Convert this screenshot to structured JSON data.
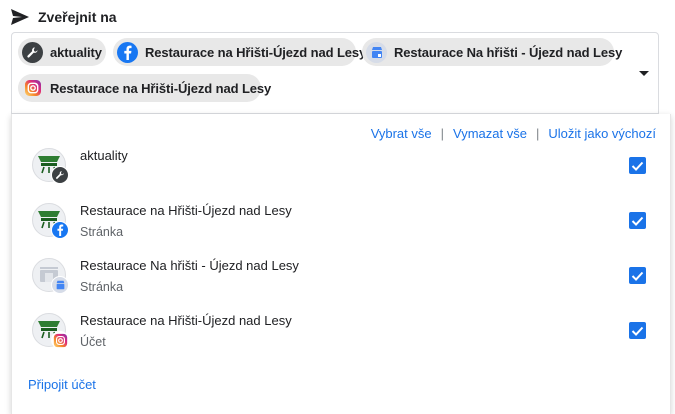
{
  "header": {
    "title": "Zveřejnit na",
    "icon": "send-icon"
  },
  "selected_chips": [
    {
      "label": "aktuality",
      "icon": "wrench-icon"
    },
    {
      "label": "Restaurace na Hřišti-Újezd nad Lesy",
      "icon": "facebook-icon"
    },
    {
      "label": "Restaurace Na hřišti - Újezd nad Lesy",
      "icon": "google-business-icon"
    },
    {
      "label": "Restaurace na Hřišti-Újezd nad Lesy",
      "icon": "instagram-icon"
    }
  ],
  "dropdown": {
    "actions": {
      "select_all": "Vybrat vše",
      "clear_all": "Vymazat vše",
      "save_default": "Uložit jako výchozí"
    },
    "accounts": [
      {
        "name": "aktuality",
        "subtitle": "",
        "badge": "wrench-icon",
        "checked": true
      },
      {
        "name": "Restaurace na Hřišti-Újezd nad Lesy",
        "subtitle": "Stránka",
        "badge": "facebook-icon",
        "checked": true
      },
      {
        "name": "Restaurace Na hřišti - Újezd nad Lesy",
        "subtitle": "Stránka",
        "badge": "google-business-icon",
        "checked": true
      },
      {
        "name": "Restaurace na Hřišti-Újezd nad Lesy",
        "subtitle": "Účet",
        "badge": "instagram-icon",
        "checked": true
      }
    ],
    "connect_account": "Připojit účet"
  },
  "colors": {
    "accent": "#1a73e8",
    "facebook": "#1877f2",
    "google_business": "#4285f4",
    "instagram_orange": "#f58529",
    "instagram_pink": "#dd2a7b",
    "chip_bg": "#e8e8e8",
    "wrench_bg": "#3c4043"
  }
}
